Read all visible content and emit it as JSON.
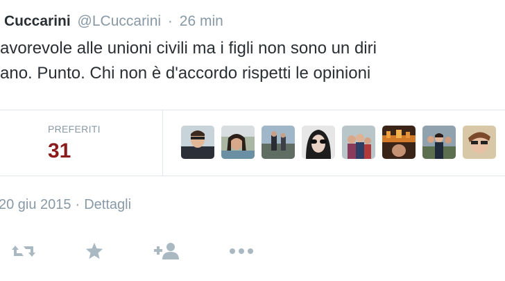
{
  "tweet": {
    "name": "Cuccarini",
    "handle": "@LCuccarini",
    "separator": "·",
    "time_ago": "26 min",
    "text_line1": "avorevole alle unioni civili ma i figli non sono un diri",
    "text_line2": "ano. Punto. Chi non è d'accordo rispetti le opinioni"
  },
  "stats": {
    "favorites_label": "PREFERITI",
    "favorites_count": "31"
  },
  "avatars": [
    {
      "name": "avatar-1"
    },
    {
      "name": "avatar-2"
    },
    {
      "name": "avatar-3"
    },
    {
      "name": "avatar-4"
    },
    {
      "name": "avatar-5"
    },
    {
      "name": "avatar-6"
    },
    {
      "name": "avatar-7"
    },
    {
      "name": "avatar-8"
    }
  ],
  "meta": {
    "date": "20 giu 2015",
    "separator": "·",
    "details_link": "Dettagli"
  },
  "actions": {
    "retweet_icon": "retweet-icon",
    "favorite_icon": "star-icon",
    "follow_icon": "add-user-icon",
    "more_icon": "more-icon"
  },
  "colors": {
    "text": "#292f33",
    "muted": "#8899a6",
    "count": "#8b1a1a",
    "icon": "#aab8c2",
    "border": "#e1e8ed"
  }
}
